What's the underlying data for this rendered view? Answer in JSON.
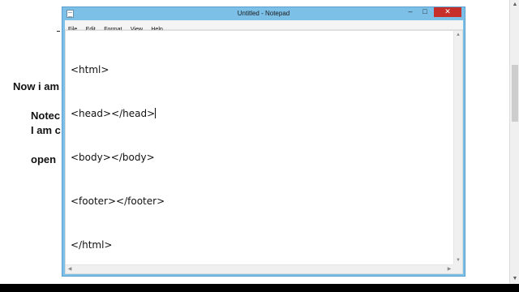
{
  "background_doc": {
    "line1": "Now i am",
    "line2": "Notec",
    "line3": "I am c",
    "line4": "open"
  },
  "notepad": {
    "title": "Untitled - Notepad",
    "menu": [
      "File",
      "Edit",
      "Format",
      "View",
      "Help"
    ],
    "lines": [
      "<html>",
      "<head>",
      "</head>",
      "<body></body>",
      "<footer></footer>",
      "</html>"
    ],
    "window_controls": {
      "minimize": "–",
      "maximize": "□",
      "close": "✕"
    }
  },
  "colors": {
    "titlebar": "#7cc0e8",
    "close_button": "#c7302a"
  }
}
